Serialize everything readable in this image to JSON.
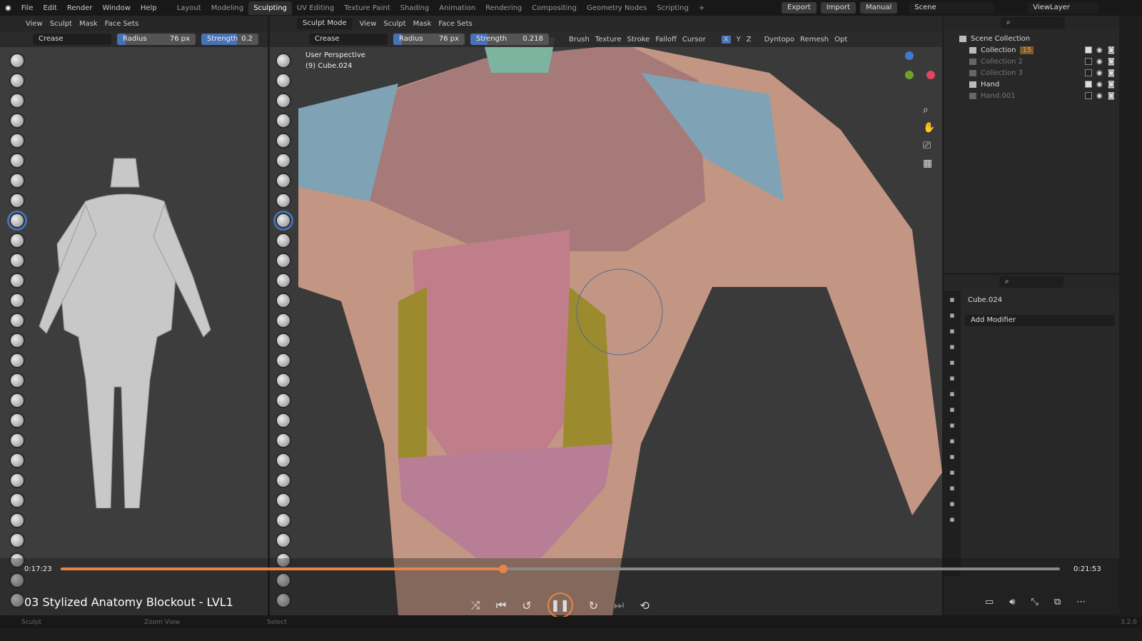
{
  "menu": [
    "File",
    "Edit",
    "Render",
    "Window",
    "Help"
  ],
  "workspaces": [
    "Layout",
    "Modeling",
    "Sculpting",
    "UV Editing",
    "Texture Paint",
    "Shading",
    "Animation",
    "Rendering",
    "Compositing",
    "Geometry Nodes",
    "Scripting",
    "+"
  ],
  "active_workspace": "Sculpting",
  "top_right": {
    "export": "Export",
    "import": "Import",
    "manual": "Manual",
    "scene": "Scene",
    "view_layer": "ViewLayer"
  },
  "left_header": {
    "items": [
      "View",
      "Sculpt",
      "Mask",
      "Face Sets"
    ]
  },
  "main_header": {
    "mode": "Sculpt Mode",
    "items": [
      "View",
      "Sculpt",
      "Mask",
      "Face Sets"
    ]
  },
  "tool_settings": {
    "brush": "Crease",
    "radius_label": "Radius",
    "radius": "76 px",
    "strength_label": "Strength",
    "strength": "0.218",
    "strength_left": "0.2",
    "menus": [
      "Brush",
      "Texture",
      "Stroke",
      "Falloff",
      "Cursor"
    ],
    "axes": [
      "X",
      "Y",
      "Z"
    ],
    "dyntopo": "Dyntopo",
    "remesh": "Remesh",
    "options": "Opt"
  },
  "viewport": {
    "perspective": "User Perspective",
    "object": "(9) Cube.024"
  },
  "outliner": {
    "root": "Scene Collection",
    "items": [
      {
        "name": "Collection",
        "enabled": true,
        "badge": "15"
      },
      {
        "name": "Collection 2",
        "enabled": false
      },
      {
        "name": "Collection 3",
        "enabled": false
      },
      {
        "name": "Hand",
        "enabled": true
      },
      {
        "name": "Hand.001",
        "enabled": false
      }
    ]
  },
  "properties": {
    "object": "Cube.024",
    "add_modifier": "Add Modifier"
  },
  "video": {
    "current": "0:17:23",
    "total": "0:21:53",
    "progress": 0.443,
    "title": "03 Stylized Anatomy Blockout - LVL1",
    "accent": "#e8834a"
  },
  "status": {
    "sculpt": "Sculpt",
    "zoom": "Zoom View",
    "select": "Select",
    "version": "3.2.0"
  }
}
